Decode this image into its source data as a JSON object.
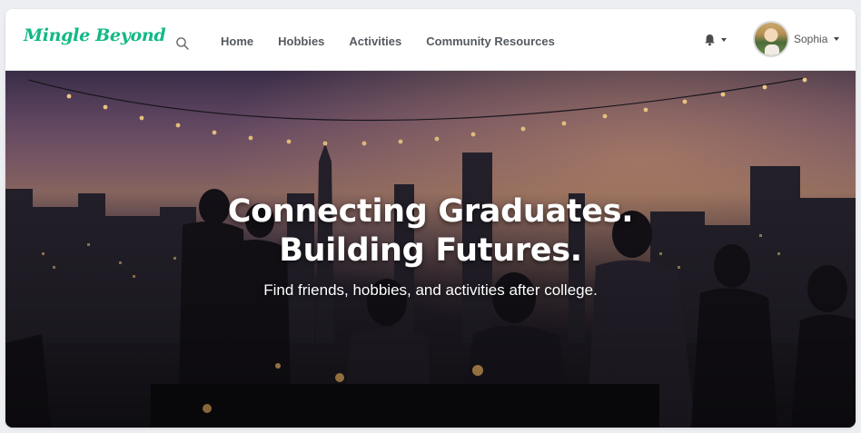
{
  "brand": {
    "name": "Mingle Beyond",
    "color": "#12b886"
  },
  "search": {
    "icon": "search-icon"
  },
  "nav": {
    "links": [
      {
        "label": "Home"
      },
      {
        "label": "Hobbies"
      },
      {
        "label": "Activities"
      },
      {
        "label": "Community Resources"
      }
    ]
  },
  "notifications": {
    "icon": "bell-icon"
  },
  "user": {
    "name": "Sophia",
    "avatar": "avatar"
  },
  "hero": {
    "title_line1": "Connecting Graduates.",
    "title_line2": "Building Futures.",
    "subtitle": "Find friends, hobbies, and activities after college."
  }
}
